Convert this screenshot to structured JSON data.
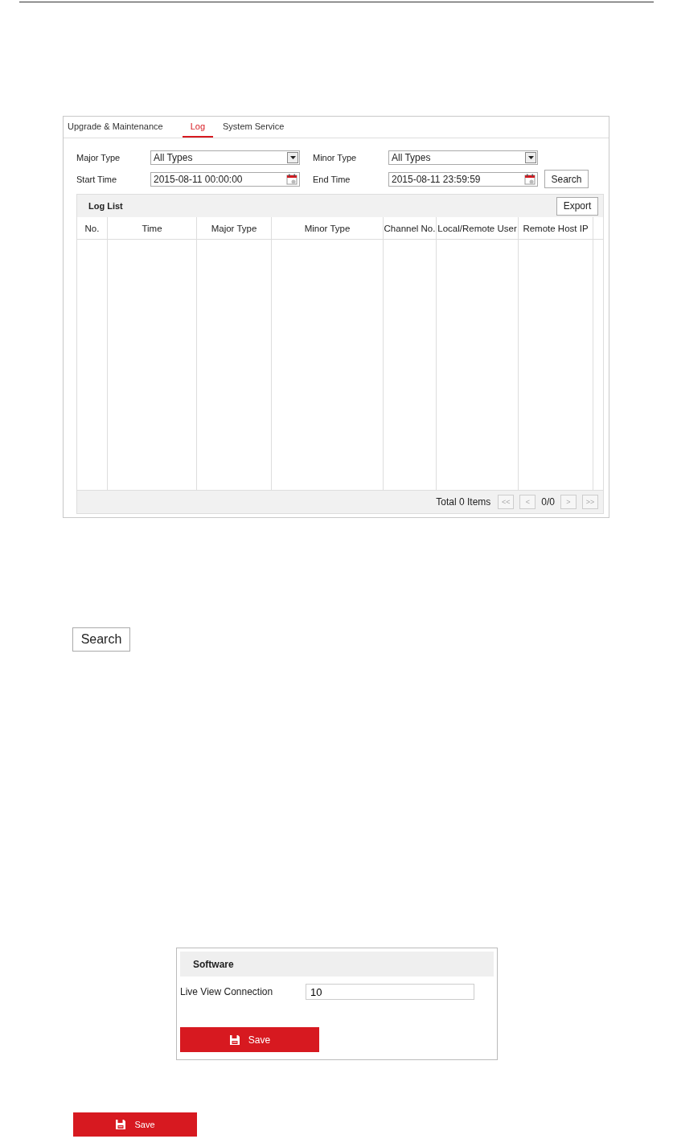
{
  "log_panel": {
    "tabs": [
      {
        "label": "Upgrade & Maintenance",
        "selected": false
      },
      {
        "label": "Log",
        "selected": true
      },
      {
        "label": "System Service",
        "selected": false
      }
    ],
    "filters": [
      {
        "kind": "select",
        "label": "Major Type",
        "value": "All Types"
      },
      {
        "kind": "select",
        "label": "Minor Type",
        "value": "All Types"
      },
      {
        "kind": "date",
        "label": "Start Time",
        "value": "2015-08-11 00:00:00"
      },
      {
        "kind": "date",
        "label": "End Time",
        "value": "2015-08-11 23:59:59"
      }
    ],
    "search_button": "Search",
    "log_list": {
      "title": "Log List",
      "export_button": "Export",
      "columns": [
        "No.",
        "Time",
        "Major Type",
        "Minor Type",
        "Channel No.",
        "Local/Remote User",
        "Remote Host IP"
      ],
      "total": "Total 0 Items",
      "pager": [
        {
          "label": "<<",
          "disabled": true
        },
        {
          "label": "<",
          "disabled": true
        },
        {
          "kind": "page",
          "label": "0/0"
        },
        {
          "label": ">",
          "disabled": true
        },
        {
          "label": ">>",
          "disabled": true
        }
      ]
    }
  },
  "search_button": "Search",
  "software_panel": {
    "title": "Software",
    "field": {
      "label": "Live View Connection",
      "value": "10"
    },
    "save_button": "Save"
  },
  "save_button": "Save"
}
